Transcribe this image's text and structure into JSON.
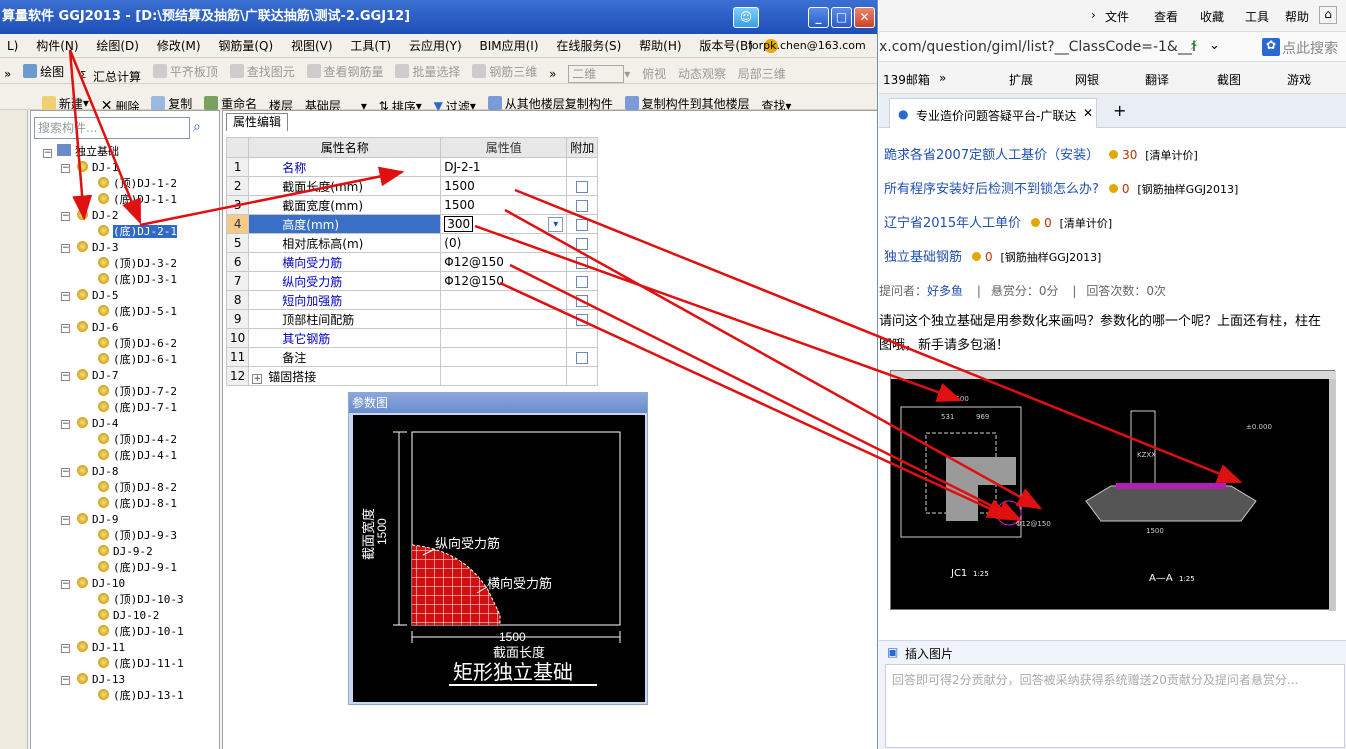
{
  "window": {
    "title": "算量软件 GGJ2013 - [D:\\预结算及抽筋\\广联达抽筋\\测试-2.GGJ12]",
    "min": "_",
    "max": "□",
    "close": "✕"
  },
  "menu": {
    "items": [
      "L)",
      "构件(N)",
      "绘图(D)",
      "修改(M)",
      "钢筋量(Q)",
      "视图(V)",
      "工具(T)",
      "云应用(Y)",
      "BIM应用(I)",
      "在线服务(S)",
      "帮助(H)",
      "版本号(B)"
    ],
    "account": "forpk.chen@163.com"
  },
  "toolbar1": {
    "items": [
      "绘图",
      "汇总计算",
      "平齐板顶",
      "查找图元",
      "查看钢筋量",
      "批量选择",
      "钢筋三维"
    ],
    "view_select": "二维",
    "more": [
      "俯视",
      "动态观察",
      "局部三维"
    ]
  },
  "toolbar2": {
    "new": "新建",
    "delete": "删除",
    "copy": "复制",
    "rename": "重命名",
    "floor_label": "楼层",
    "floor_value": "基础层",
    "sort": "排序",
    "filter": "过滤",
    "copy_from": "从其他楼层复制构件",
    "copy_to": "复制构件到其他楼层",
    "find": "查找"
  },
  "tree": {
    "search_placeholder": "搜索构件...",
    "root": "独立基础",
    "nodes": [
      {
        "label": "DJ-1",
        "level": 1
      },
      {
        "label": "(顶)DJ-1-2",
        "level": 2
      },
      {
        "label": "(底)DJ-1-1",
        "level": 2
      },
      {
        "label": "DJ-2",
        "level": 1
      },
      {
        "label": "(底)DJ-2-1",
        "level": 2,
        "selected": true
      },
      {
        "label": "DJ-3",
        "level": 1
      },
      {
        "label": "(顶)DJ-3-2",
        "level": 2
      },
      {
        "label": "(底)DJ-3-1",
        "level": 2
      },
      {
        "label": "DJ-5",
        "level": 1
      },
      {
        "label": "(底)DJ-5-1",
        "level": 2
      },
      {
        "label": "DJ-6",
        "level": 1
      },
      {
        "label": "(顶)DJ-6-2",
        "level": 2
      },
      {
        "label": "(底)DJ-6-1",
        "level": 2
      },
      {
        "label": "DJ-7",
        "level": 1
      },
      {
        "label": "(顶)DJ-7-2",
        "level": 2
      },
      {
        "label": "(底)DJ-7-1",
        "level": 2
      },
      {
        "label": "DJ-4",
        "level": 1
      },
      {
        "label": "(顶)DJ-4-2",
        "level": 2
      },
      {
        "label": "(底)DJ-4-1",
        "level": 2
      },
      {
        "label": "DJ-8",
        "level": 1
      },
      {
        "label": "(顶)DJ-8-2",
        "level": 2
      },
      {
        "label": "(底)DJ-8-1",
        "level": 2
      },
      {
        "label": "DJ-9",
        "level": 1
      },
      {
        "label": "(顶)DJ-9-3",
        "level": 2
      },
      {
        "label": "DJ-9-2",
        "level": 2
      },
      {
        "label": "(底)DJ-9-1",
        "level": 2
      },
      {
        "label": "DJ-10",
        "level": 1
      },
      {
        "label": "(顶)DJ-10-3",
        "level": 2
      },
      {
        "label": "DJ-10-2",
        "level": 2
      },
      {
        "label": "(底)DJ-10-1",
        "level": 2
      },
      {
        "label": "DJ-11",
        "level": 1
      },
      {
        "label": "(底)DJ-11-1",
        "level": 2
      },
      {
        "label": "DJ-13",
        "level": 1
      },
      {
        "label": "(底)DJ-13-1",
        "level": 2
      }
    ]
  },
  "props": {
    "tab": "属性编辑",
    "headers": [
      "属性名称",
      "属性值",
      "附加"
    ],
    "rows": [
      {
        "no": "1",
        "name": "名称",
        "value": "DJ-2-1",
        "blue": true,
        "check": false
      },
      {
        "no": "2",
        "name": "截面长度(mm)",
        "value": "1500",
        "blue": false,
        "check": true
      },
      {
        "no": "3",
        "name": "截面宽度(mm)",
        "value": "1500",
        "blue": false,
        "check": true
      },
      {
        "no": "4",
        "name": "高度(mm)",
        "value": "300",
        "blue": false,
        "check": true,
        "selected": true
      },
      {
        "no": "5",
        "name": "相对底标高(m)",
        "value": "(0)",
        "blue": false,
        "check": true
      },
      {
        "no": "6",
        "name": "横向受力筋",
        "value": "Φ12@150",
        "blue": true,
        "check": true
      },
      {
        "no": "7",
        "name": "纵向受力筋",
        "value": "Φ12@150",
        "blue": true,
        "check": true
      },
      {
        "no": "8",
        "name": "短向加强筋",
        "value": "",
        "blue": true,
        "check": true
      },
      {
        "no": "9",
        "name": "顶部柱间配筋",
        "value": "",
        "blue": false,
        "check": true
      },
      {
        "no": "10",
        "name": "其它钢筋",
        "value": "",
        "blue": true,
        "check": false
      },
      {
        "no": "11",
        "name": "备注",
        "value": "",
        "blue": false,
        "check": true
      },
      {
        "no": "12",
        "name": "锚固搭接",
        "value": "",
        "blue": false,
        "check": false,
        "expand": true
      }
    ]
  },
  "param": {
    "title": "参数图",
    "width_dim": "1500",
    "width_label": "截面宽度",
    "length_dim": "1500",
    "length_label": "截面长度",
    "long_bar": "纵向受力筋",
    "trans_bar": "横向受力筋",
    "caption": "矩形独立基础"
  },
  "browser": {
    "menu": [
      "文件",
      "查看",
      "收藏",
      "工具",
      "帮助"
    ],
    "url": "x.com/question/giml/list?__ClassCode=-1&__I",
    "search_placeholder": "点此搜索",
    "fav": [
      "139邮箱",
      "扩展",
      "网银",
      "翻译",
      "截图",
      "游戏"
    ],
    "tab_title": "专业造价问题答疑平台-广联达",
    "questions": [
      {
        "title": "跪求各省2007定额人工基价（安装）",
        "score": "30",
        "tag": "[清单计价]"
      },
      {
        "title": "所有程序安装好后检测不到锁怎么办?",
        "score": "0",
        "tag": "[钢筋抽样GGJ2013]"
      },
      {
        "title": "辽宁省2015年人工单价",
        "score": "0",
        "tag": "[清单计价]"
      },
      {
        "title": "独立基础钢筋",
        "score": "0",
        "tag": "[钢筋抽样GGJ2013]"
      }
    ],
    "meta": {
      "asker_label": "提问者：",
      "asker": "好多鱼",
      "bounty": "悬赏分：0分",
      "answers": "回答次数：0次"
    },
    "body_line1": "请问这个独立基础是用参数化来画吗？参数化的哪一个呢？上面还有柱，柱在",
    "body_line2": "图哦，新手请多包涵！",
    "drawing": {
      "title1": "JC1",
      "scale1": "1:25",
      "title2": "A—A",
      "scale2": "1:25",
      "dim1": "1500",
      "dim2": "531",
      "dim3": "969",
      "rebar": "Φ12@150",
      "col": "KZXX",
      "elev": "±0.000"
    },
    "insert_image": "插入图片",
    "answer_hint": "回答即可得2分贡献分，回答被采纳获得系统赠送20贡献分及提问者悬赏分..."
  },
  "colors": {
    "accent": "#316ac5",
    "arrow": "#e01010",
    "header_highlight": "#f5c988"
  }
}
